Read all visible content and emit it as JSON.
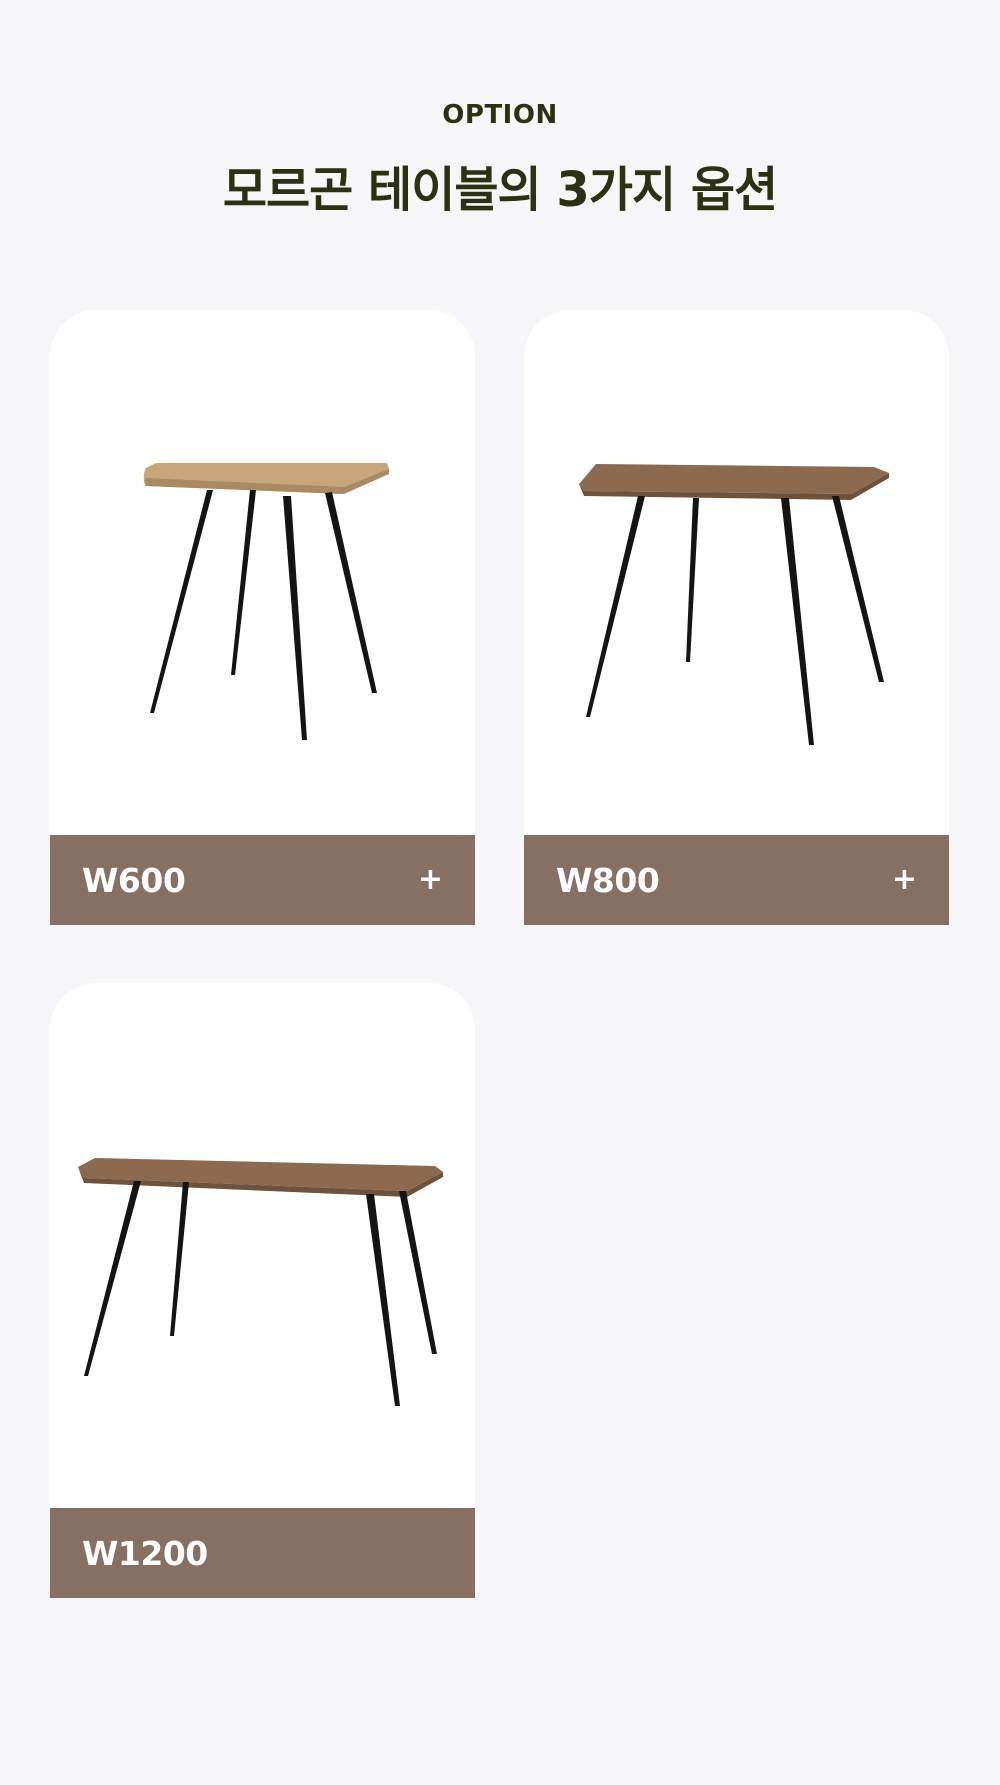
{
  "header": {
    "eyebrow": "OPTION",
    "title": "모르곤 테이블의 3가지 옵션"
  },
  "options": [
    {
      "label": "W600",
      "action": "+",
      "top_color": "#c7a77a",
      "icon": "small-square-table"
    },
    {
      "label": "W800",
      "action": "+",
      "top_color": "#8b6a50",
      "icon": "square-table"
    },
    {
      "label": "W1200",
      "top_color": "#8b6a50",
      "icon": "rectangular-table"
    }
  ],
  "colors": {
    "background": "#f6f6f8",
    "title": "#2c3114",
    "label_bar": "#876f61",
    "legs": "#141414"
  }
}
